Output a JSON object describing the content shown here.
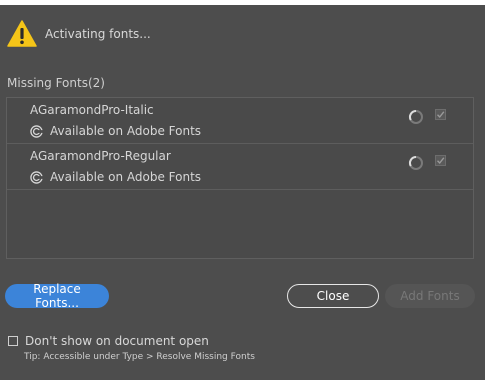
{
  "status": {
    "message": "Activating fonts...",
    "icon": "warning-icon",
    "icon_color": "#f5c518"
  },
  "missing_fonts": {
    "title": "Missing Fonts(2)",
    "items": [
      {
        "name": "AGaramondPro-Italic",
        "availability": "Available on Adobe Fonts",
        "checked": true,
        "loading": true
      },
      {
        "name": "AGaramondPro-Regular",
        "availability": "Available on Adobe Fonts",
        "checked": true,
        "loading": true
      }
    ]
  },
  "buttons": {
    "replace_label": "Replace Fonts...",
    "close_label": "Close",
    "add_label": "Add Fonts"
  },
  "footer": {
    "dont_show_label": "Don't show on document open",
    "tip": "Tip: Accessible under Type > Resolve Missing Fonts"
  },
  "colors": {
    "accent": "#3c84d9",
    "background": "#4d4d4d"
  }
}
